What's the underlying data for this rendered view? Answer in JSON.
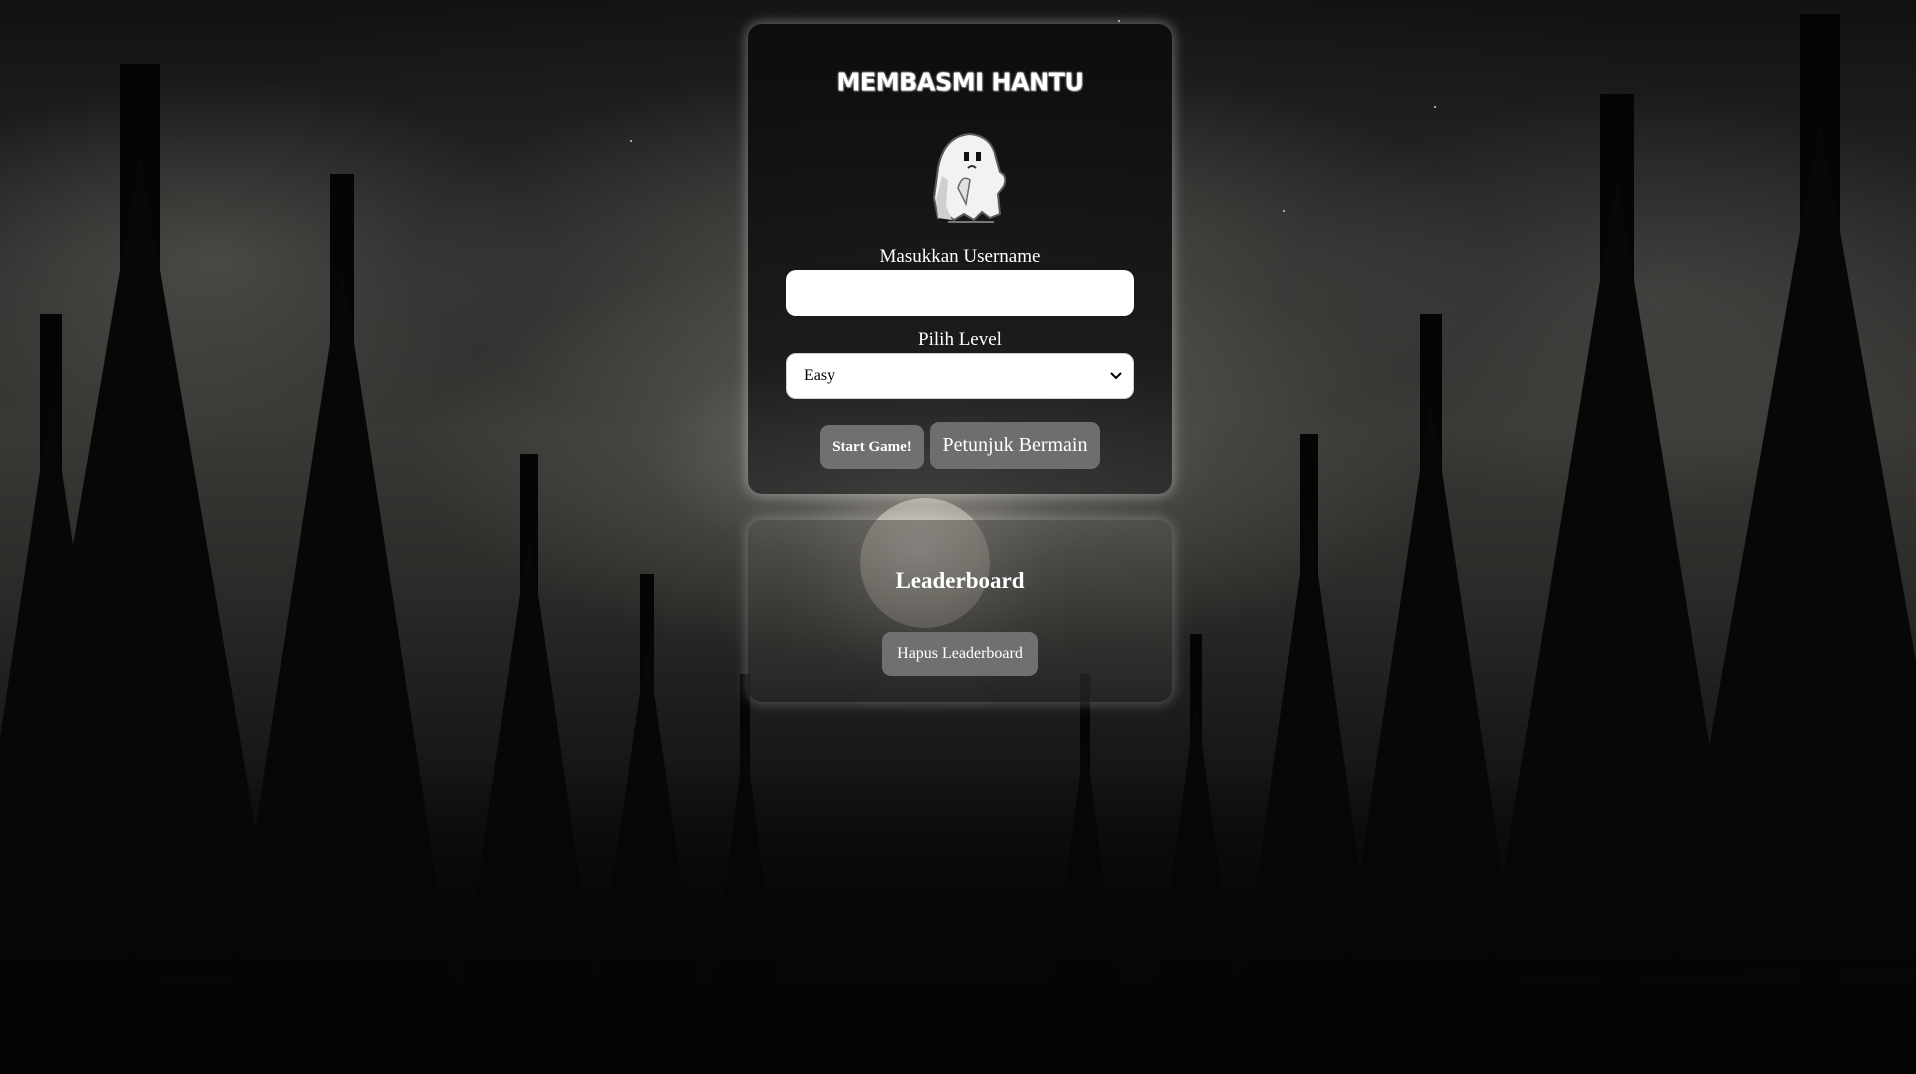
{
  "game": {
    "title": "MEMBASMI HANTU"
  },
  "form": {
    "username_label": "Masukkan Username",
    "username_value": "",
    "username_placeholder": "",
    "level_label": "Pilih Level",
    "level_selected": "Easy"
  },
  "buttons": {
    "start": "Start Game!",
    "guide": "Petunjuk Bermain"
  },
  "leaderboard": {
    "title": "Leaderboard",
    "clear_button": "Hapus Leaderboard"
  },
  "icons": {
    "ghost": "ghost-icon",
    "chevron": "chevron-down-icon"
  },
  "colors": {
    "button_bg": "#707070",
    "panel_glow": "#ffffff",
    "text": "#ffffff"
  }
}
